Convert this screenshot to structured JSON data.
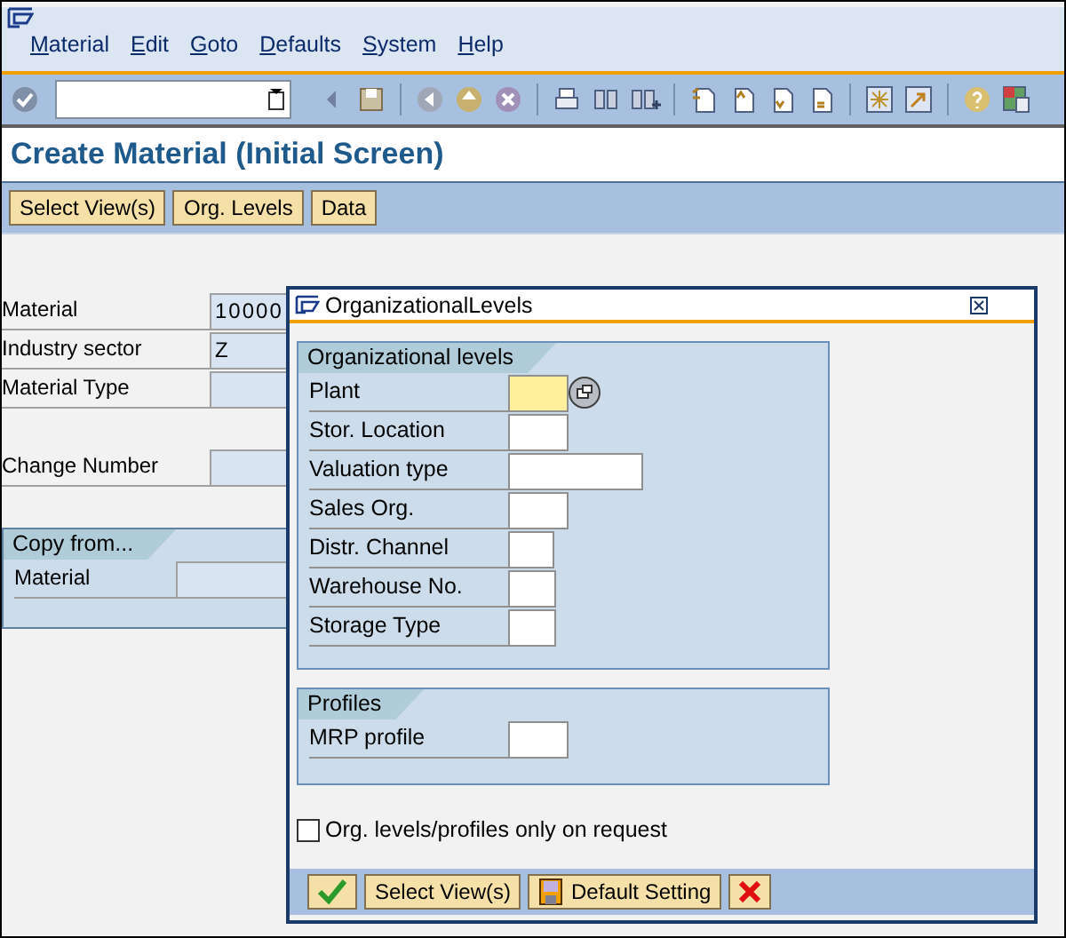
{
  "menu": [
    {
      "label": "Material"
    },
    {
      "label": "Edit"
    },
    {
      "label": "Goto"
    },
    {
      "label": "Defaults"
    },
    {
      "label": "System"
    },
    {
      "label": "Help"
    }
  ],
  "title": "Create Material (Initial Screen)",
  "app_toolbar": [
    "Select View(s)",
    "Org. Levels",
    "Data"
  ],
  "header_fields": [
    {
      "label": "Material",
      "value": "10000"
    },
    {
      "label": "Industry sector",
      "value": "Z"
    },
    {
      "label": "Material Type"
    }
  ],
  "change_fields": [
    {
      "label": "Change Number"
    }
  ],
  "copy_from": {
    "title": "Copy from...",
    "fields": [
      {
        "label": "Material"
      }
    ]
  },
  "dialog": {
    "title": "OrganizationalLevels",
    "groups": [
      {
        "title": "Organizational levels",
        "fields": [
          {
            "label": "Plant",
            "kind": "medium",
            "focused": true
          },
          {
            "label": "Stor. Location",
            "kind": "medium",
            "focused": false
          },
          {
            "label": "Valuation type",
            "kind": "large",
            "focused": false
          },
          {
            "label": "Sales Org.",
            "kind": "medium",
            "focused": false
          },
          {
            "label": "Distr. Channel",
            "kind": "tiny",
            "focused": false
          },
          {
            "label": "Warehouse No.",
            "kind": "small",
            "focused": false
          },
          {
            "label": "Storage Type",
            "kind": "small",
            "focused": false
          }
        ]
      },
      {
        "title": "Profiles",
        "fields": [
          {
            "label": "MRP profile",
            "kind": "medium",
            "focused": false
          }
        ]
      }
    ],
    "checkbox": {
      "label": "Org. levels/profiles only on request",
      "checked": false
    },
    "buttons": [
      {
        "kind": "confirm"
      },
      {
        "kind": "text",
        "label": "Select View(s)"
      },
      {
        "kind": "save",
        "label": "Default Setting"
      },
      {
        "kind": "cancel"
      }
    ]
  }
}
